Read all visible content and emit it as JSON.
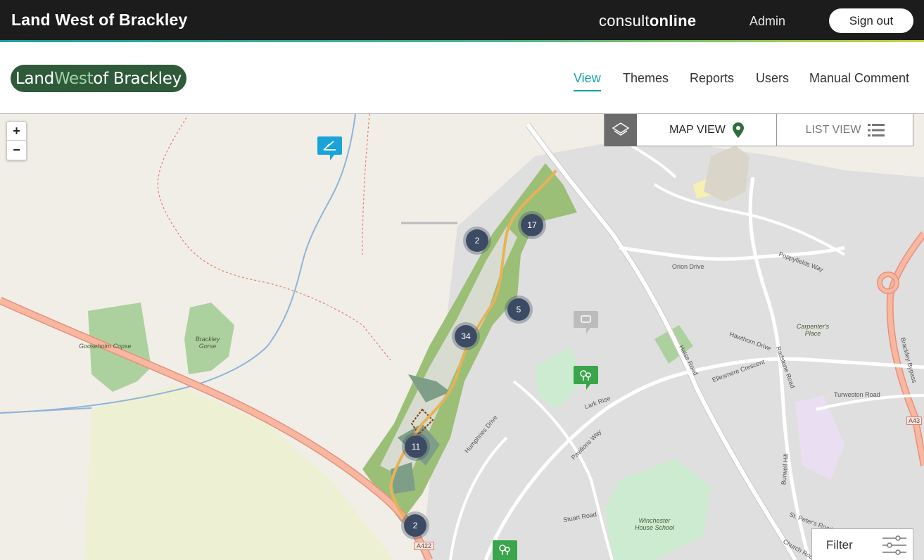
{
  "app": {
    "title": "Land West of Brackley"
  },
  "brand": {
    "part1": "consult",
    "part2": "online"
  },
  "user": {
    "admin_label": "Admin",
    "signout_label": "Sign out"
  },
  "project": {
    "logo_part1": "Land ",
    "logo_part2": "West",
    "logo_part3": " of Brackley"
  },
  "nav": [
    {
      "label": "View",
      "active": true
    },
    {
      "label": "Themes",
      "active": false
    },
    {
      "label": "Reports",
      "active": false
    },
    {
      "label": "Users",
      "active": false
    },
    {
      "label": "Manual Comment",
      "active": false
    }
  ],
  "map": {
    "zoom_in": "+",
    "zoom_out": "−",
    "map_view_label": "MAP VIEW",
    "list_view_label": "LIST VIEW",
    "filter_label": "Filter",
    "clusters": [
      "2",
      "17",
      "5",
      "34",
      "11",
      "2"
    ],
    "labels": {
      "gooseholm": "Gooseholm Copse",
      "gorse": "Brackley Gorse",
      "carpenters": "Carpenter's Place",
      "winchester": "Winchester House School",
      "halse_road": "Halse Road",
      "humphries": "Humphries Drive",
      "pavilions": "Pavilions Way",
      "poppyfields": "Poppyfields Way",
      "bypass": "Brackley Bypass",
      "a422": "A422",
      "a43": "A43",
      "turweston": "Turweston Road",
      "radstone": "Radstone Road",
      "orion": "Orion Drive",
      "hawthorn": "Hawthorn Drive",
      "ellesmere": "Ellesmere Crescent",
      "stuart": "Stuart Road",
      "burwell": "Burwell Hill",
      "lark": "Lark Rise",
      "stpeters": "St. Peter's Road",
      "church": "Church Road"
    },
    "colors": {
      "accent": "#1aa3a3",
      "cluster": "#3c4a63",
      "road_major": "#f2a488",
      "green": "#a8d59a"
    }
  }
}
